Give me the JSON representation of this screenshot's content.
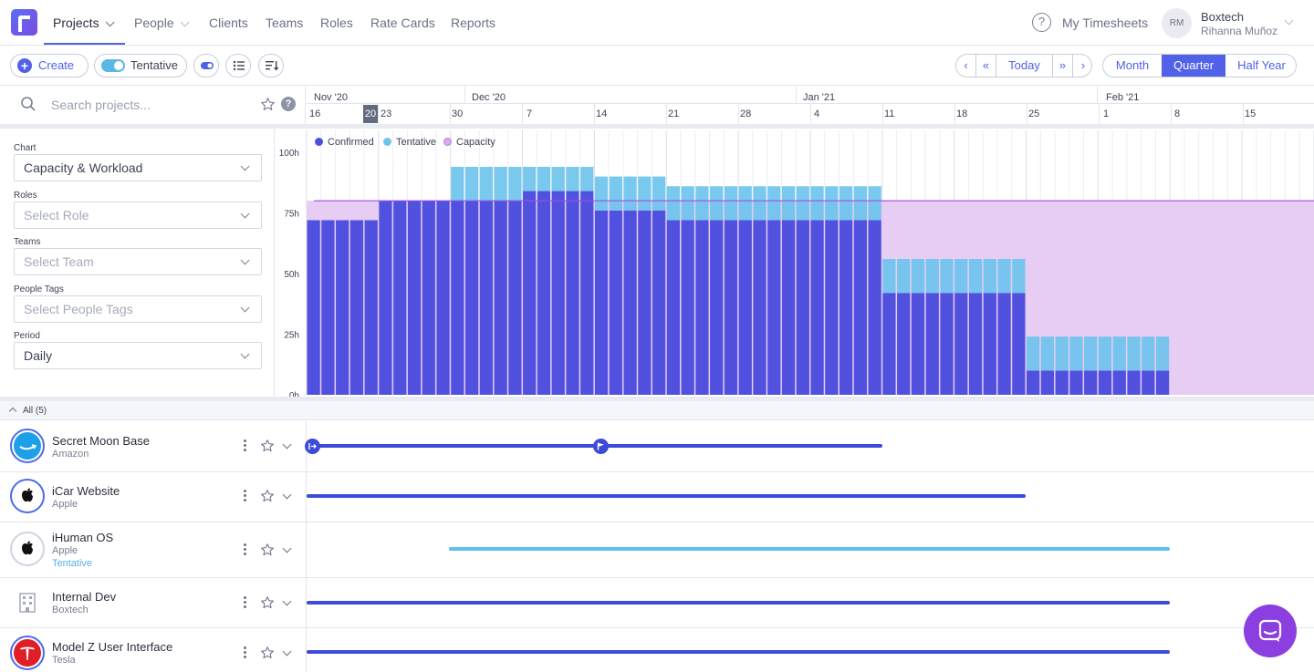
{
  "nav": {
    "items": [
      {
        "label": "Projects",
        "active": true,
        "dropdown": true
      },
      {
        "label": "People",
        "active": false,
        "dropdown": true
      },
      {
        "label": "Clients",
        "active": false,
        "dropdown": false
      },
      {
        "label": "Teams",
        "active": false,
        "dropdown": false
      },
      {
        "label": "Roles",
        "active": false,
        "dropdown": false
      },
      {
        "label": "Rate Cards",
        "active": false,
        "dropdown": false
      },
      {
        "label": "Reports",
        "active": false,
        "dropdown": false
      }
    ],
    "help_glyph": "?",
    "timesheets_label": "My Timesheets",
    "user_initials": "RM",
    "user_company": "Boxtech",
    "user_name": "Rihanna Muñoz"
  },
  "toolbar": {
    "create_label": "Create",
    "tentative_label": "Tentative",
    "tentative_on": true,
    "today_label": "Today",
    "ranges": [
      {
        "label": "Month",
        "active": false
      },
      {
        "label": "Quarter",
        "active": true
      },
      {
        "label": "Half Year",
        "active": false
      }
    ]
  },
  "search": {
    "placeholder": "Search projects...",
    "help_glyph": "?"
  },
  "timeline": {
    "months": [
      "Nov '20",
      "Dec '20",
      "Jan '21",
      "Feb '21"
    ],
    "weeks": [
      "16",
      "23",
      "30",
      "7",
      "14",
      "21",
      "28",
      "4",
      "11",
      "18",
      "25",
      "1",
      "8",
      "15"
    ],
    "today": "20"
  },
  "filters": {
    "chart_label": "Chart",
    "chart_value": "Capacity & Workload",
    "roles_label": "Roles",
    "roles_placeholder": "Select Role",
    "teams_label": "Teams",
    "teams_placeholder": "Select Team",
    "tags_label": "People Tags",
    "tags_placeholder": "Select People Tags",
    "period_label": "Period",
    "period_value": "Daily"
  },
  "chart_data": {
    "type": "bar",
    "stacked": true,
    "y_ticks": [
      "100h",
      "75h",
      "50h",
      "25h",
      "0h"
    ],
    "ylim": [
      0,
      100
    ],
    "capacity": 80,
    "legend": [
      {
        "label": "Confirmed",
        "color": "#4b4fe0"
      },
      {
        "label": "Tentative",
        "color": "#6ec4ee"
      },
      {
        "label": "Capacity",
        "color": "#d9a9ee"
      }
    ],
    "segments": [
      {
        "days": 5,
        "confirmed": 72,
        "tentative": 0
      },
      {
        "days": 5,
        "confirmed": 80,
        "tentative": 0
      },
      {
        "days": 5,
        "confirmed": 80,
        "tentative": 14
      },
      {
        "days": 5,
        "confirmed": 84,
        "tentative": 10
      },
      {
        "days": 5,
        "confirmed": 76,
        "tentative": 14
      },
      {
        "days": 15,
        "confirmed": 72,
        "tentative": 14
      },
      {
        "days": 10,
        "confirmed": 42,
        "tentative": 14
      },
      {
        "days": 10,
        "confirmed": 10,
        "tentative": 14
      },
      {
        "days": 10,
        "confirmed": 0,
        "tentative": 0
      }
    ]
  },
  "group": {
    "label": "All (5)"
  },
  "projects": [
    {
      "name": "Secret Moon Base",
      "client": "Amazon",
      "status": "",
      "color": "#3e4bd8"
    },
    {
      "name": "iCar Website",
      "client": "Apple",
      "status": "",
      "color": "#3e4bd8"
    },
    {
      "name": "iHuman OS",
      "client": "Apple",
      "status": "Tentative",
      "color": "#5bc0ec"
    },
    {
      "name": "Internal Dev",
      "client": "Boxtech",
      "status": "",
      "color": "#3e4bd8"
    },
    {
      "name": "Model Z User Interface",
      "client": "Tesla",
      "status": "",
      "color": "#3e4bd8"
    }
  ]
}
